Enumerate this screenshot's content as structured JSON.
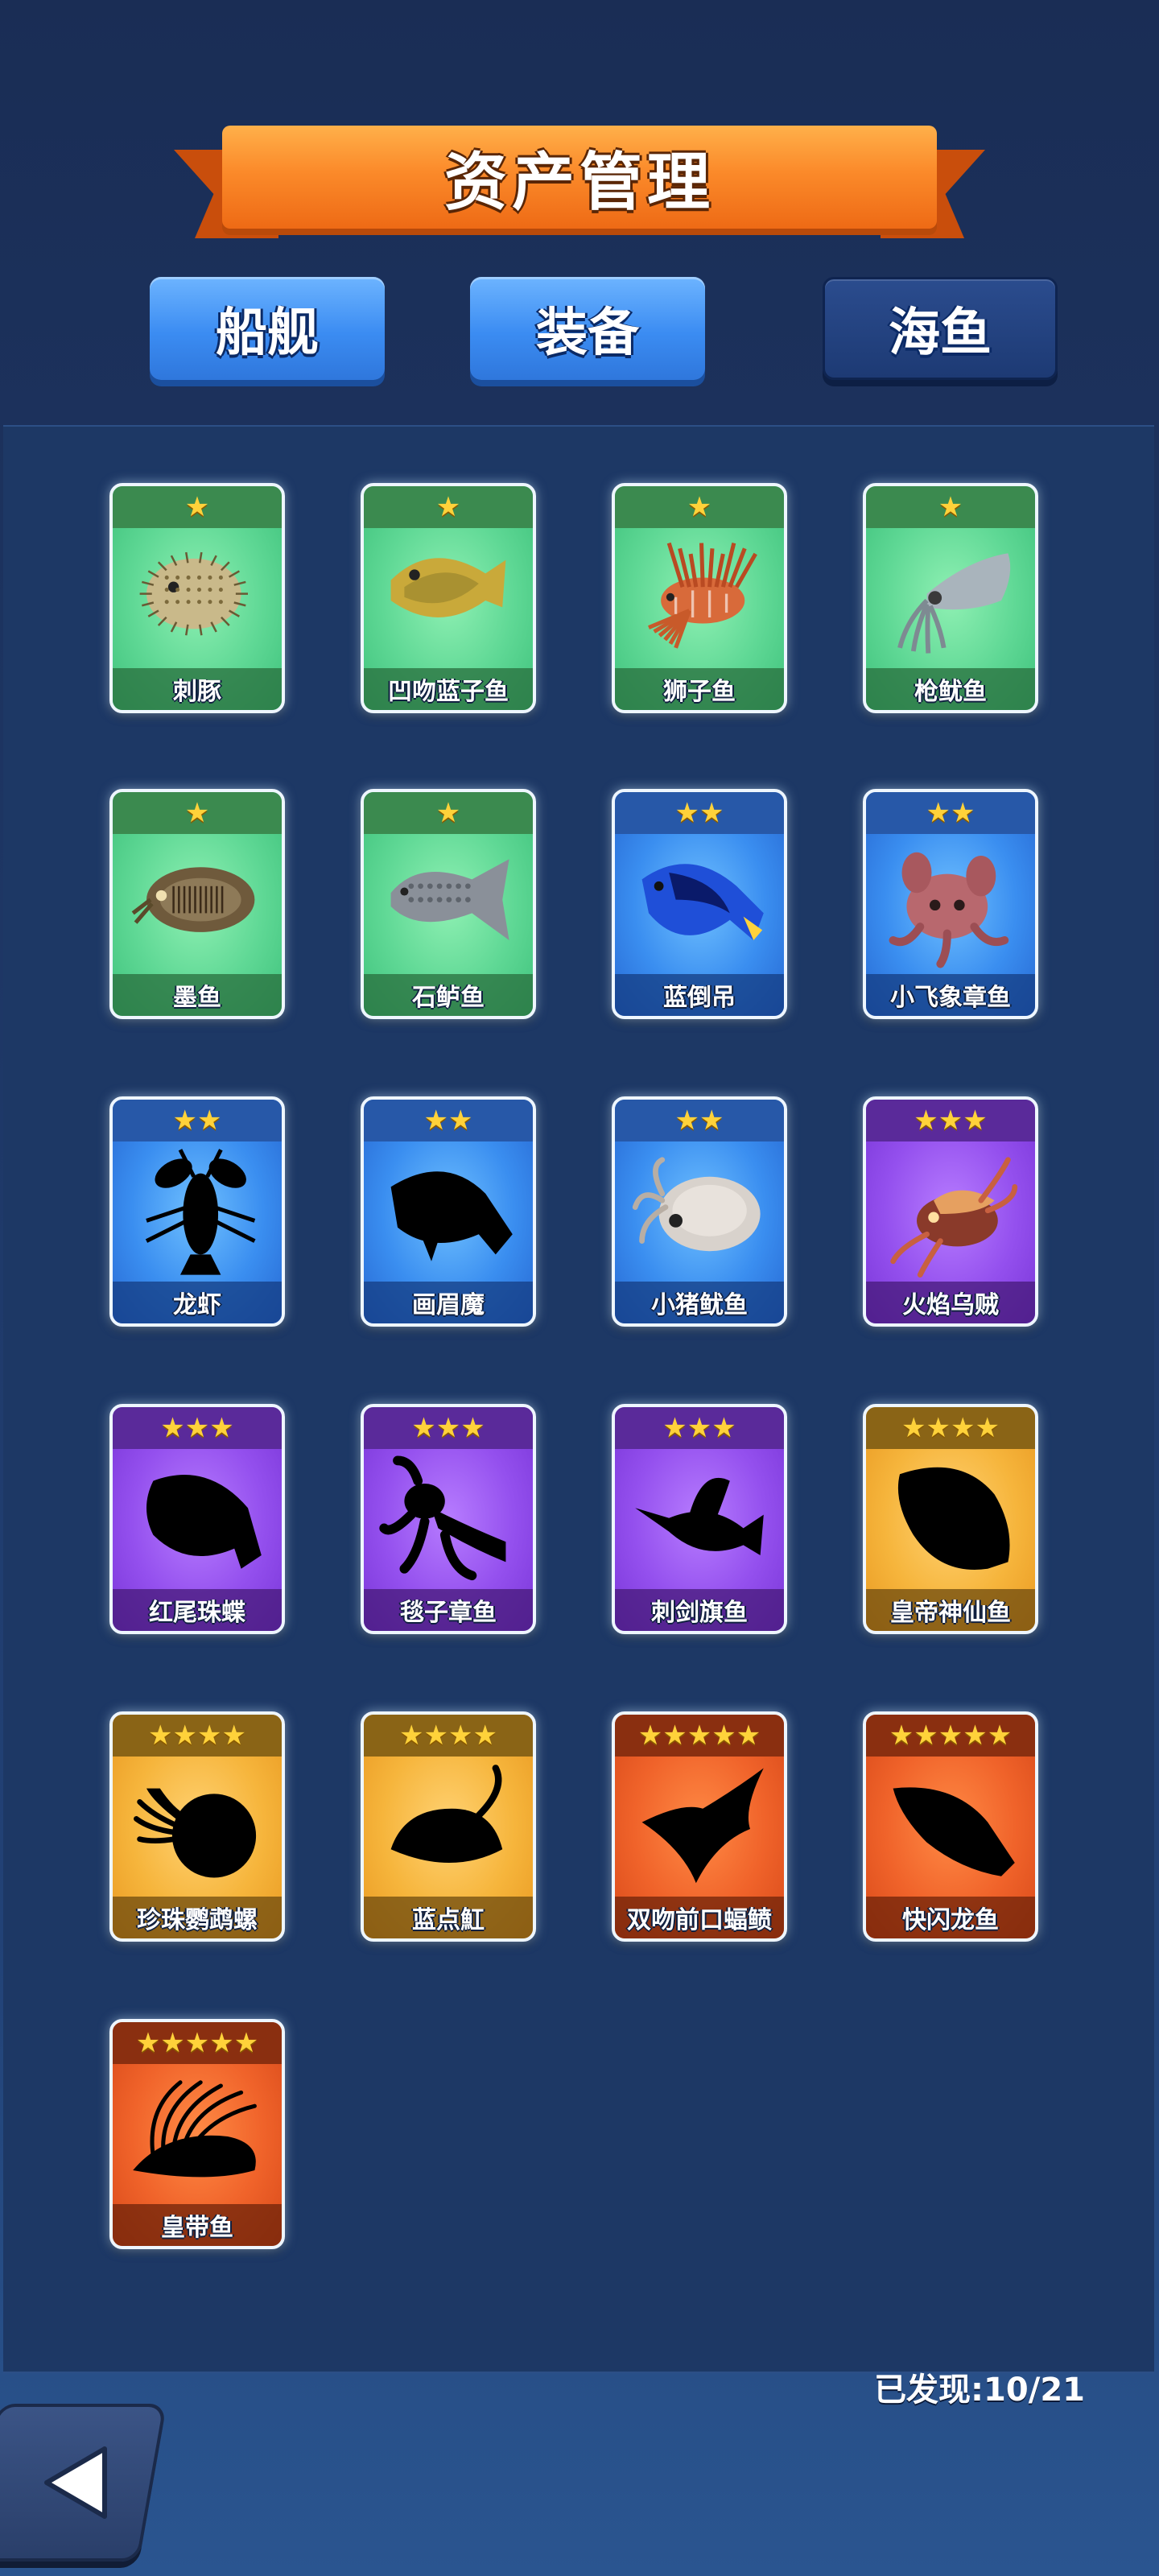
{
  "header": {
    "title": "资产管理"
  },
  "tabs": [
    {
      "label": "船舰",
      "state": "inactive"
    },
    {
      "label": "装备",
      "state": "inactive"
    },
    {
      "label": "海鱼",
      "state": "active"
    }
  ],
  "colors": {
    "rarity_1": "#5fd895",
    "rarity_2": "#3a8ef0",
    "rarity_3": "#9450ee",
    "rarity_4": "#f6b53c",
    "rarity_5": "#f0632a",
    "star": "#ffd23a"
  },
  "fish": [
    {
      "name": "刺豚",
      "stars": "★",
      "rarity": "green",
      "discovered": true,
      "icon": "pufferfish-icon"
    },
    {
      "name": "凹吻蓝子鱼",
      "stars": "★",
      "rarity": "green",
      "discovered": true,
      "icon": "rabbitfish-icon"
    },
    {
      "name": "狮子鱼",
      "stars": "★",
      "rarity": "green",
      "discovered": true,
      "icon": "lionfish-icon"
    },
    {
      "name": "枪鱿鱼",
      "stars": "★",
      "rarity": "green",
      "discovered": true,
      "icon": "squid-icon"
    },
    {
      "name": "墨鱼",
      "stars": "★",
      "rarity": "green",
      "discovered": true,
      "icon": "cuttlefish-icon"
    },
    {
      "name": "石鲈鱼",
      "stars": "★",
      "rarity": "green",
      "discovered": true,
      "icon": "grunt-fish-icon"
    },
    {
      "name": "蓝倒吊",
      "stars": "★★",
      "rarity": "blue",
      "discovered": true,
      "icon": "blue-tang-icon"
    },
    {
      "name": "小飞象章鱼",
      "stars": "★★",
      "rarity": "blue",
      "discovered": true,
      "icon": "dumbo-octopus-icon"
    },
    {
      "name": "龙虾",
      "stars": "★★",
      "rarity": "blue",
      "discovered": false,
      "icon": "lobster-silhouette-icon"
    },
    {
      "name": "画眉魔",
      "stars": "★★",
      "rarity": "blue",
      "discovered": false,
      "icon": "fish-silhouette-icon"
    },
    {
      "name": "小猪鱿鱼",
      "stars": "★★",
      "rarity": "blue",
      "discovered": true,
      "icon": "piglet-squid-icon"
    },
    {
      "name": "火焰乌贼",
      "stars": "★★★",
      "rarity": "purple",
      "discovered": true,
      "icon": "flamboyant-cuttlefish-icon"
    },
    {
      "name": "红尾珠蝶",
      "stars": "★★★",
      "rarity": "purple",
      "discovered": false,
      "icon": "butterflyfish-silhouette-icon"
    },
    {
      "name": "毯子章鱼",
      "stars": "★★★",
      "rarity": "purple",
      "discovered": false,
      "icon": "blanket-octopus-silhouette-icon"
    },
    {
      "name": "刺剑旗鱼",
      "stars": "★★★",
      "rarity": "purple",
      "discovered": false,
      "icon": "sailfish-silhouette-icon"
    },
    {
      "name": "皇帝神仙鱼",
      "stars": "★★★★",
      "rarity": "gold",
      "discovered": false,
      "icon": "angelfish-silhouette-icon"
    },
    {
      "name": "珍珠鹦鹉螺",
      "stars": "★★★★",
      "rarity": "gold",
      "discovered": false,
      "icon": "nautilus-silhouette-icon"
    },
    {
      "name": "蓝点魟",
      "stars": "★★★★",
      "rarity": "gold",
      "discovered": false,
      "icon": "stingray-silhouette-icon"
    },
    {
      "name": "双吻前口蝠鲼",
      "stars": "★★★★★",
      "rarity": "orange",
      "discovered": false,
      "icon": "manta-ray-silhouette-icon"
    },
    {
      "name": "快闪龙鱼",
      "stars": "★★★★★",
      "rarity": "orange",
      "discovered": false,
      "icon": "dragonfish-silhouette-icon"
    },
    {
      "name": "皇带鱼",
      "stars": "★★★★★",
      "rarity": "orange",
      "discovered": false,
      "icon": "oarfish-silhouette-icon"
    }
  ],
  "footer": {
    "found_label": "已发现:10/21"
  }
}
